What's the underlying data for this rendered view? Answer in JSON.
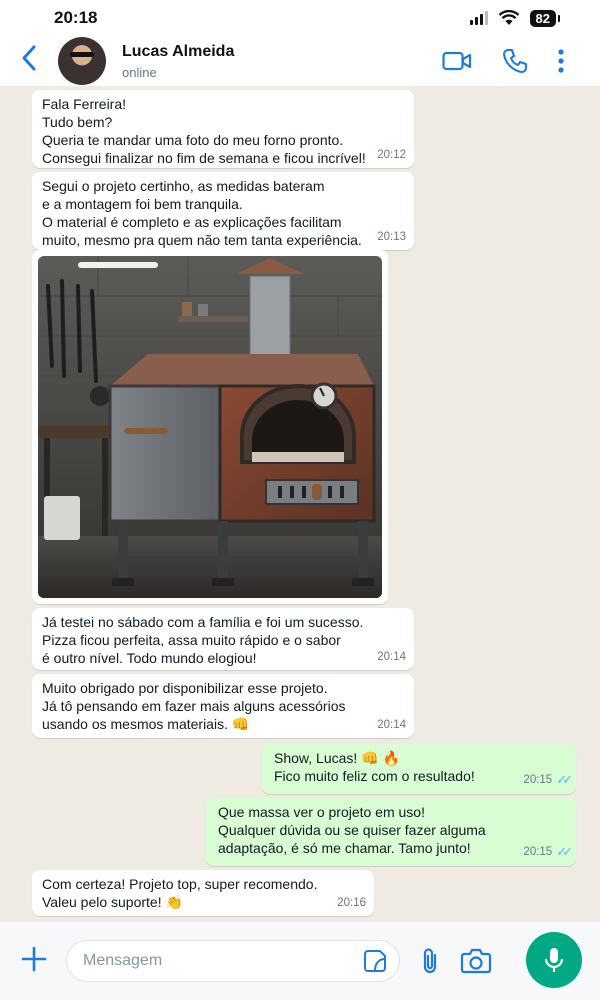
{
  "status_bar": {
    "time": "20:18",
    "battery": "82"
  },
  "header": {
    "contact_name": "Lucas Almeida",
    "contact_status": "online",
    "icons": [
      "back-icon",
      "video-call-icon",
      "voice-call-icon",
      "more-options-icon"
    ]
  },
  "messages": [
    {
      "direction": "in",
      "text": "Fala Ferreira!\nTudo bem?\nQueria te mandar uma foto do meu forno pronto.\nConsegui finalizar no fim de semana e ficou incrível!",
      "time": "20:12"
    },
    {
      "direction": "in",
      "text": "Segui o projeto certinho, as medidas bateram\ne a montagem foi bem tranquila.\nO material é completo e as explicações facilitam\nmuito, mesmo pra quem não tem tanta experiência.",
      "time": "20:13"
    },
    {
      "direction": "in",
      "type": "image",
      "image": "wood-fired-oven-photo"
    },
    {
      "direction": "in",
      "text": "Já testei no sábado com a família e foi um sucesso.\nPizza ficou perfeita, assa muito rápido e o sabor\né outro nível. Todo mundo elogiou!",
      "time": "20:14"
    },
    {
      "direction": "in",
      "text": "Muito obrigado por disponibilizar esse projeto.\nJá tô pensando em fazer mais alguns acessórios\nusando os mesmos materiais. 👊",
      "time": "20:14"
    },
    {
      "direction": "out",
      "text": "Show, Lucas! 👊 🔥\nFico muito feliz com o resultado!",
      "time": "20:15"
    },
    {
      "direction": "out",
      "text": "Que massa ver o projeto em uso!\nQualquer dúvida ou se quiser fazer alguma\nadaptação, é só me chamar. Tamo junto!",
      "time": "20:15"
    },
    {
      "direction": "in",
      "text": "Com certeza! Projeto top, super recomendo.\nValeu pelo suporte! 👏",
      "time": "20:16"
    }
  ],
  "input": {
    "placeholder": "Mensagem"
  },
  "colors": {
    "accent": "#1f7ae0",
    "outgoing_bubble": "#d9fdd3",
    "incoming_bubble": "#ffffff",
    "chat_background": "#efeae2",
    "mic_button": "#00a884",
    "read_ticks": "#53bdeb"
  }
}
